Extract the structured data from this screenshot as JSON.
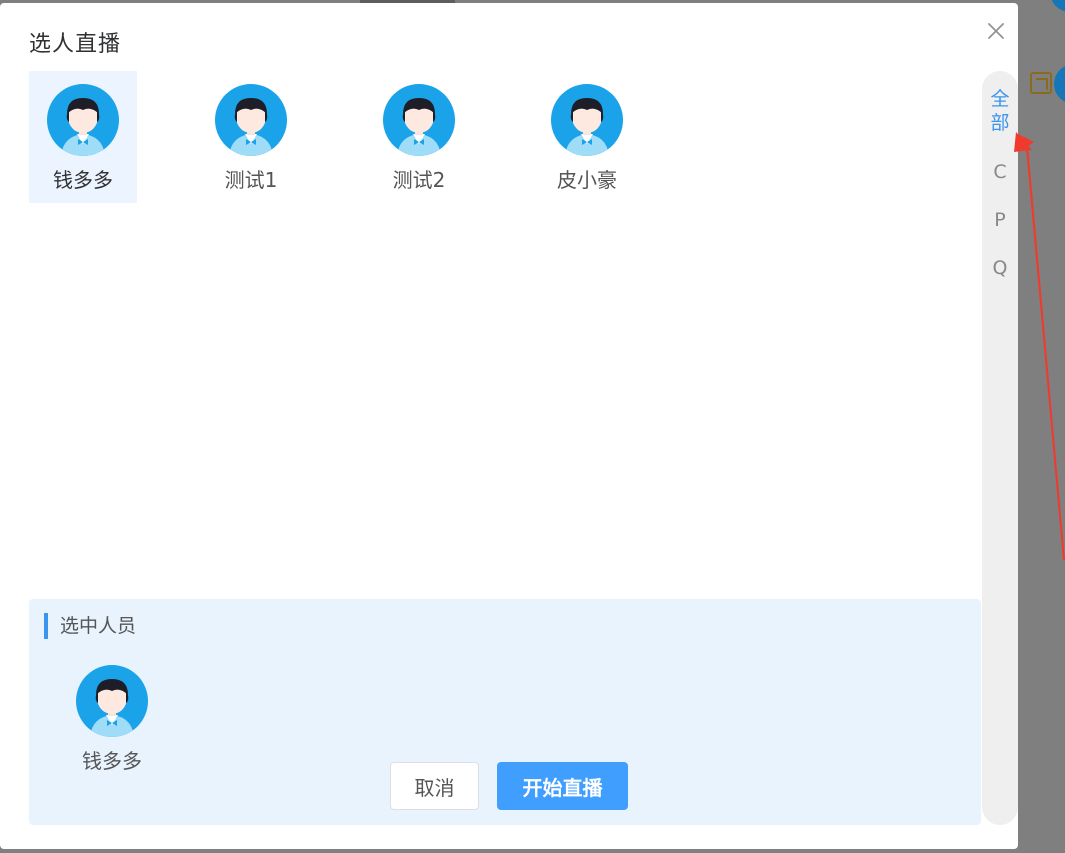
{
  "dialog": {
    "title": "选人直播",
    "close_icon": "close-icon"
  },
  "people": [
    {
      "name": "钱多多",
      "selected": true
    },
    {
      "name": "测试1",
      "selected": false
    },
    {
      "name": "测试2",
      "selected": false
    },
    {
      "name": "皮小豪",
      "selected": false
    }
  ],
  "index_bar": {
    "all_line1": "全",
    "all_line2": "部",
    "letters": [
      "C",
      "P",
      "Q"
    ],
    "active": "全部"
  },
  "selected_panel": {
    "title": "选中人员",
    "people": [
      {
        "name": "钱多多"
      }
    ]
  },
  "buttons": {
    "cancel": "取消",
    "start": "开始直播"
  },
  "colors": {
    "accent": "#409eff",
    "avatar_bg": "#1aa3e8",
    "selected_bg": "#ecf5ff",
    "panel_bg": "#e8f3fd",
    "annotation_arrow": "#f03a2e"
  }
}
